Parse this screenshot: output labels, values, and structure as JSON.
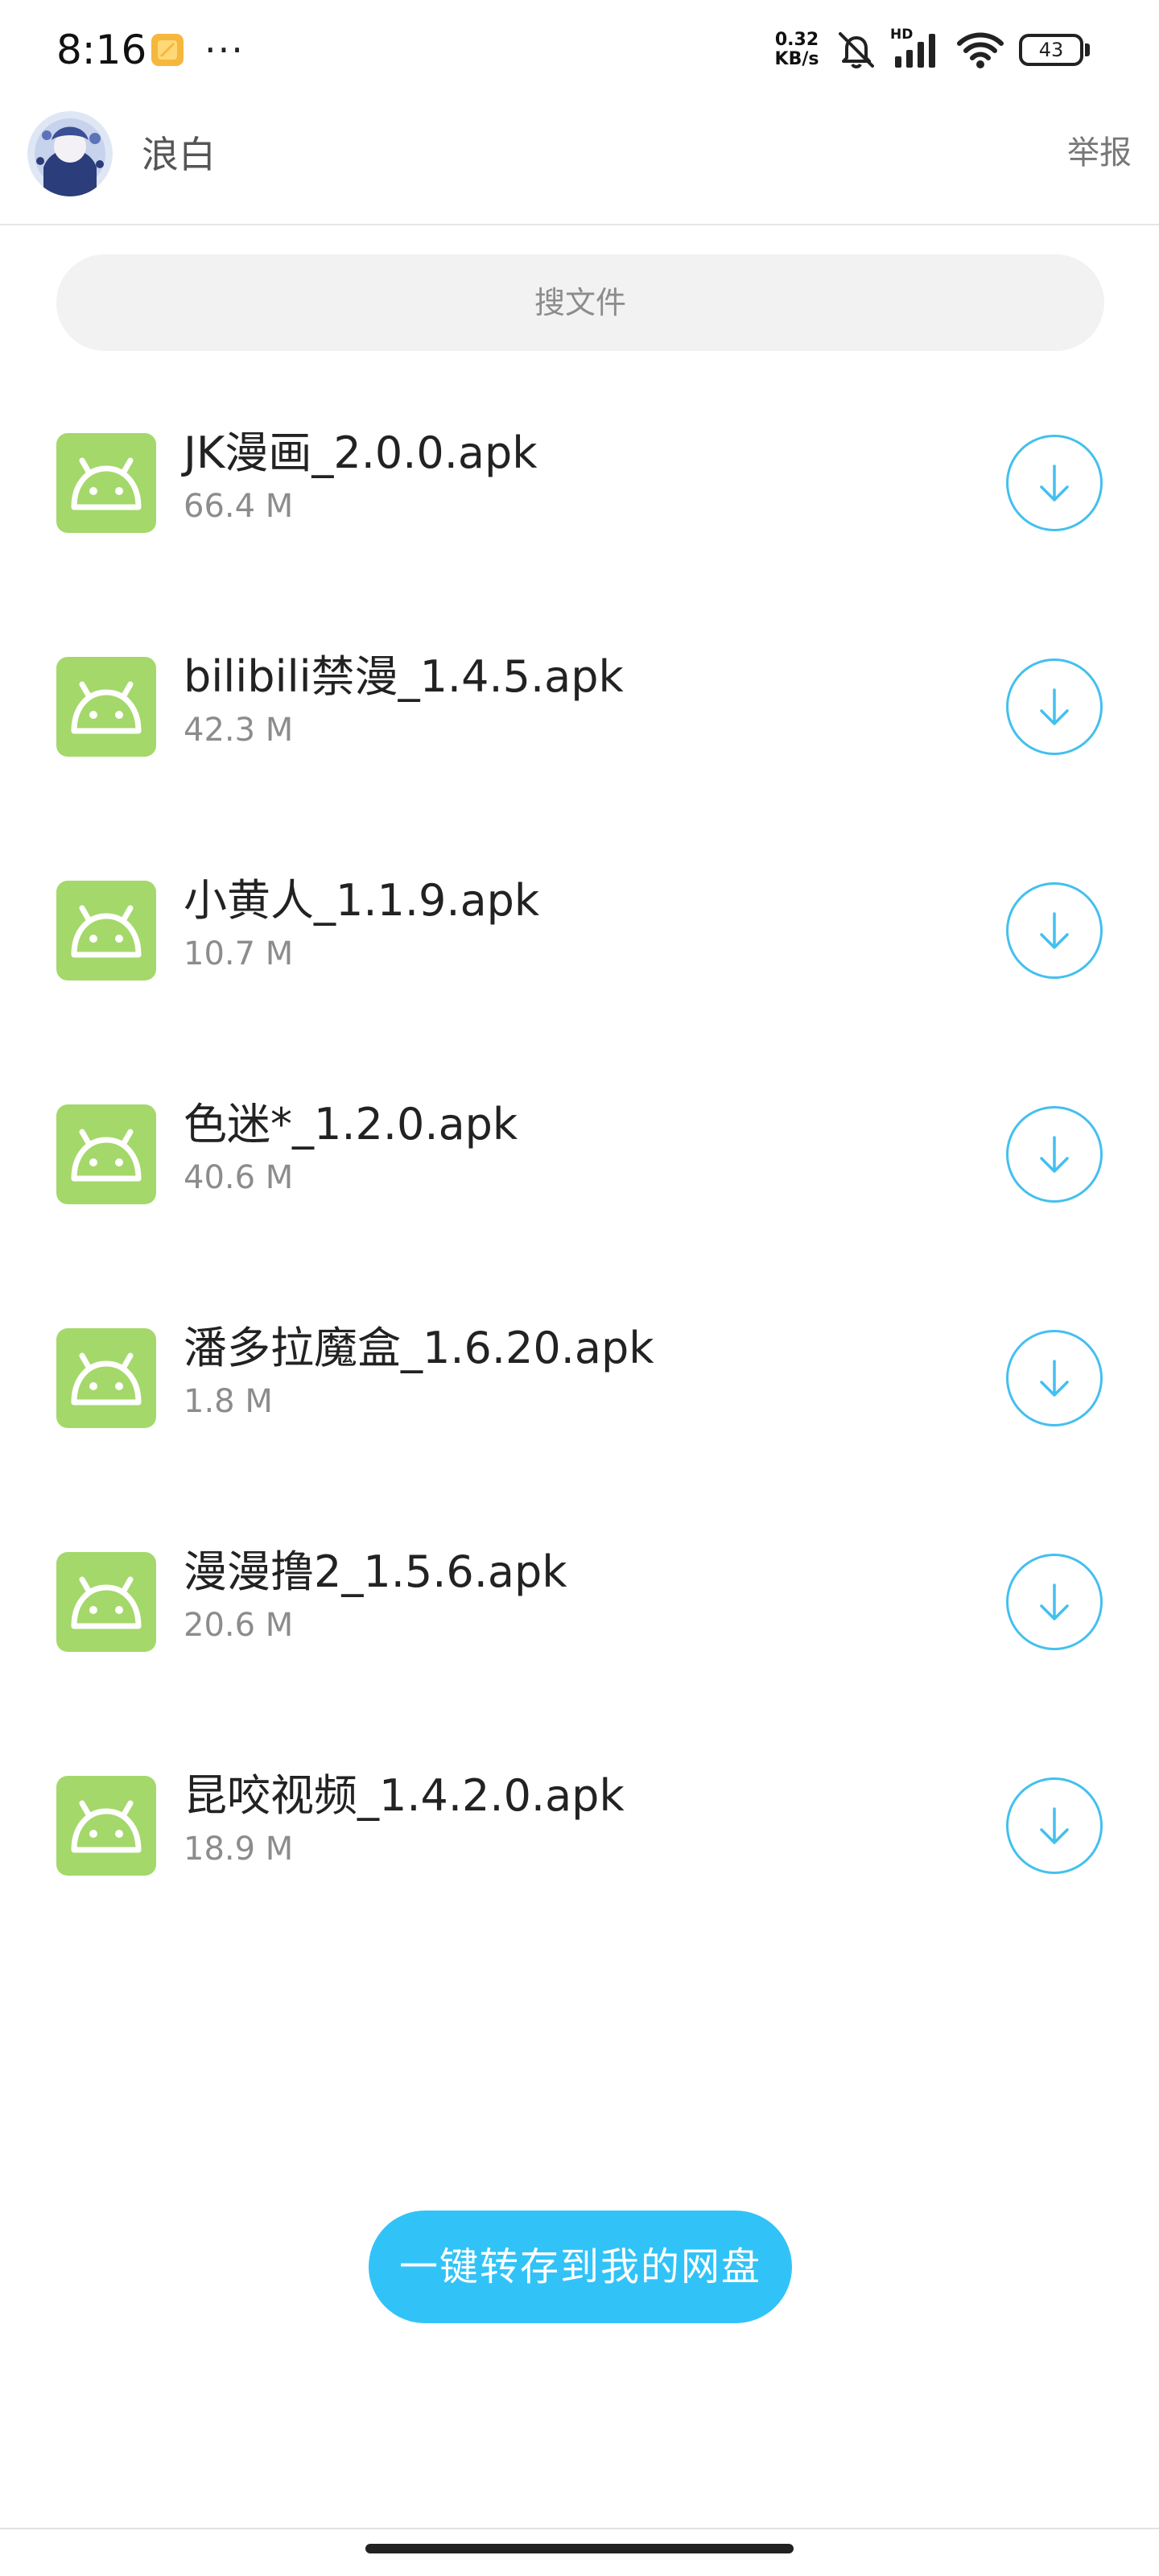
{
  "status_bar": {
    "time": "8:16",
    "more": "···",
    "speed_value": "0.32",
    "speed_unit": "KB/s",
    "hd_label": "HD",
    "battery": "43",
    "icons": [
      "notification-icon",
      "mute-icon",
      "signal-icon",
      "wifi-icon",
      "battery-icon"
    ]
  },
  "header": {
    "username": "浪白",
    "report_label": "举报"
  },
  "search": {
    "placeholder": "搜文件"
  },
  "files": [
    {
      "name": "JK漫画_2.0.0.apk",
      "size": "66.4 M"
    },
    {
      "name": "bilibili禁漫_1.4.5.apk",
      "size": "42.3 M"
    },
    {
      "name": "小黄人_1.1.9.apk",
      "size": "10.7 M"
    },
    {
      "name": "色迷*_1.2.0.apk",
      "size": "40.6 M"
    },
    {
      "name": "潘多拉魔盒_1.6.20.apk",
      "size": "1.8 M"
    },
    {
      "name": "漫漫撸2_1.5.6.apk",
      "size": "20.6 M"
    },
    {
      "name": "昆咬视频_1.4.2.0.apk",
      "size": "18.9 M"
    }
  ],
  "save_button": {
    "label": "一键转存到我的网盘"
  },
  "colors": {
    "accent": "#31c3f7",
    "download_ring": "#43c0ee",
    "apk_icon_bg": "#a4d86a",
    "search_bg": "#f2f2f2"
  }
}
